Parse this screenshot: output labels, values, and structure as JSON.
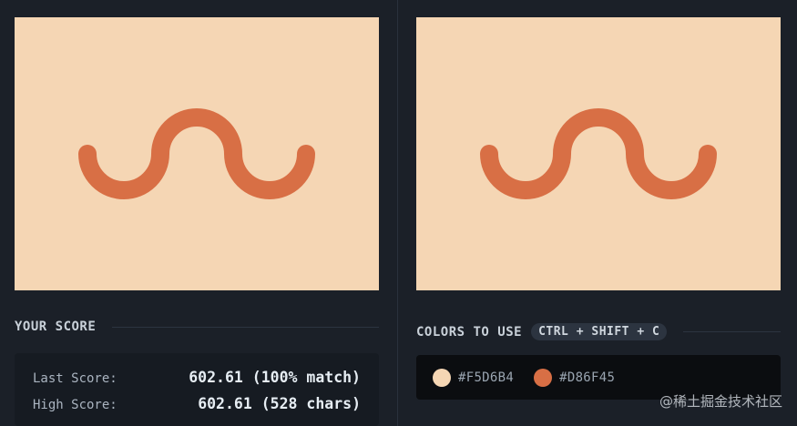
{
  "score": {
    "heading": "YOUR SCORE",
    "last_label": "Last Score:",
    "last_value": "602.61 (100% match)",
    "high_label": "High Score:",
    "high_value": "602.61 (528 chars)"
  },
  "colors": {
    "heading": "COLORS TO USE",
    "shortcut": "CTRL + SHIFT + C",
    "swatches": [
      {
        "label": "#F5D6B4",
        "hex": "#F5D6B4"
      },
      {
        "label": "#D86F45",
        "hex": "#D86F45"
      }
    ]
  },
  "canvas": {
    "background": "#F5D6B4",
    "shape_color": "#D86F45"
  },
  "watermark": "@稀土掘金技术社区"
}
